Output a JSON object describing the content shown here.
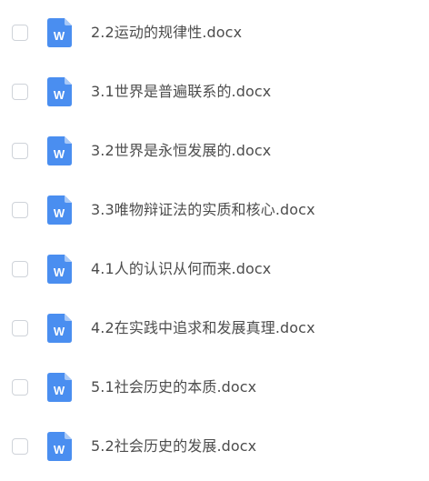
{
  "files": [
    {
      "name": "2.2运动的规律性.docx",
      "icon": "word-doc-icon",
      "checked": false
    },
    {
      "name": "3.1世界是普遍联系的.docx",
      "icon": "word-doc-icon",
      "checked": false
    },
    {
      "name": "3.2世界是永恒发展的.docx",
      "icon": "word-doc-icon",
      "checked": false
    },
    {
      "name": "3.3唯物辩证法的实质和核心.docx",
      "icon": "word-doc-icon",
      "checked": false
    },
    {
      "name": "4.1人的认识从何而来.docx",
      "icon": "word-doc-icon",
      "checked": false
    },
    {
      "name": "4.2在实践中追求和发展真理.docx",
      "icon": "word-doc-icon",
      "checked": false
    },
    {
      "name": "5.1社会历史的本质.docx",
      "icon": "word-doc-icon",
      "checked": false
    },
    {
      "name": "5.2社会历史的发展.docx",
      "icon": "word-doc-icon",
      "checked": false
    }
  ],
  "icon_letter": "W",
  "colors": {
    "icon_blue": "#4a8ef0",
    "icon_fold": "#a9c9f7",
    "text": "#4d4d4d",
    "checkbox_border": "#cfd3d9"
  }
}
